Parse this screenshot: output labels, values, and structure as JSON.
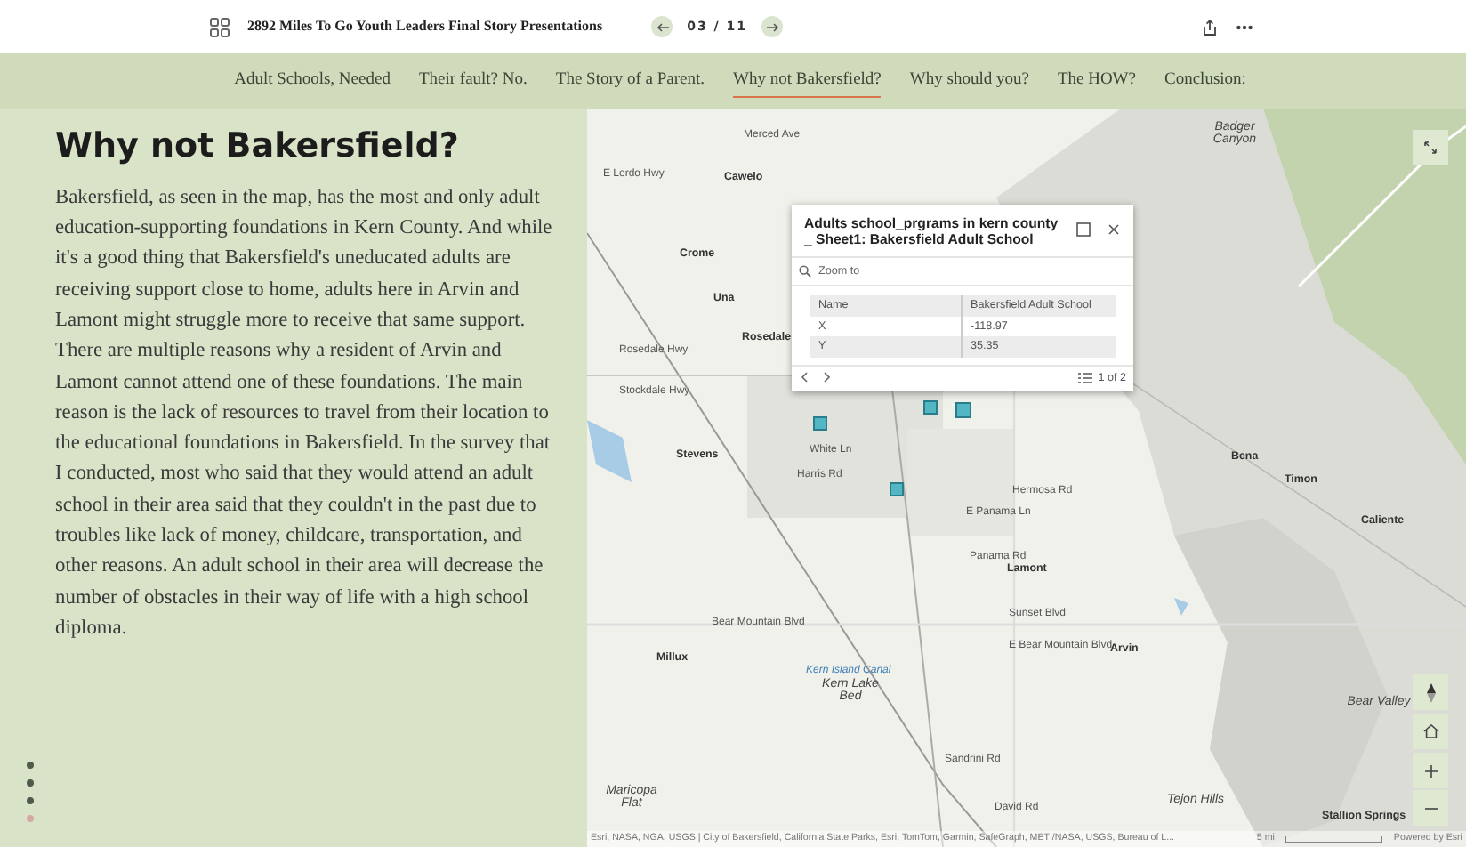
{
  "top_bar": {
    "title": "2892 Miles To Go Youth Leaders Final Story Presentations",
    "page_indicator": "03 / 11"
  },
  "nav": [
    {
      "label": "Adult Schools, Needed",
      "selected": false
    },
    {
      "label": "Their fault? No.",
      "selected": false
    },
    {
      "label": "The Story of a Parent.",
      "selected": false
    },
    {
      "label": "Why not Bakersfield?",
      "selected": true
    },
    {
      "label": "Why should you?",
      "selected": false
    },
    {
      "label": "The HOW?",
      "selected": false
    },
    {
      "label": "Conclusion:",
      "selected": false
    }
  ],
  "story": {
    "heading": "Why not Bakersfield?",
    "body": "Bakersfield, as seen in the map, has the most and only adult education-supporting foundations in Kern County. And while it's a good thing that Bakersfield's uneducated adults are receiving support close to home, adults here in Arvin and Lamont might struggle more to receive that same support. There are multiple reasons why a resident of Arvin and Lamont cannot attend one of these foundations. The main reason is the lack of resources to travel from their location to the educational foundations in Bakersfield. In the survey that I conducted, most who said that they would attend an adult school in their area said that they couldn't in the past due to troubles like lack of money, childcare, transportation, and other reasons. An adult school in their area will decrease the number of obstacles in their way of life with a high school diploma."
  },
  "slide_dots": [
    {
      "selected": false
    },
    {
      "selected": false
    },
    {
      "selected": false
    },
    {
      "selected": true
    }
  ],
  "map": {
    "labels": [
      {
        "text": "Merced Ave",
        "kind": "road"
      },
      {
        "text": "E Lerdo Hwy",
        "kind": "road"
      },
      {
        "text": "Cawelo",
        "kind": "place"
      },
      {
        "text": "Badger Canyon",
        "kind": "terrain"
      },
      {
        "text": "Crome",
        "kind": "place"
      },
      {
        "text": "Una",
        "kind": "place"
      },
      {
        "text": "Rosedale",
        "kind": "place"
      },
      {
        "text": "Rosedale Hwy",
        "kind": "road"
      },
      {
        "text": "Stockdale Hwy",
        "kind": "road"
      },
      {
        "text": "Stevens",
        "kind": "place"
      },
      {
        "text": "White Ln",
        "kind": "road"
      },
      {
        "text": "Harris Rd",
        "kind": "road"
      },
      {
        "text": "Hermosa Rd",
        "kind": "road"
      },
      {
        "text": "E Panama Ln",
        "kind": "road"
      },
      {
        "text": "Panama Rd",
        "kind": "road"
      },
      {
        "text": "Lamont",
        "kind": "place"
      },
      {
        "text": "Bena",
        "kind": "place"
      },
      {
        "text": "Timon",
        "kind": "place"
      },
      {
        "text": "Caliente",
        "kind": "place"
      },
      {
        "text": "Sunset Blvd",
        "kind": "road"
      },
      {
        "text": "Bear Mountain Blvd",
        "kind": "road"
      },
      {
        "text": "E Bear Mountain Blvd",
        "kind": "road"
      },
      {
        "text": "Arvin",
        "kind": "place"
      },
      {
        "text": "Millux",
        "kind": "place"
      },
      {
        "text": "Kern Island Canal",
        "kind": "water"
      },
      {
        "text": "Kern Lake Bed",
        "kind": "terrain"
      },
      {
        "text": "Bear Valley",
        "kind": "terrain"
      },
      {
        "text": "Sandrini Rd",
        "kind": "road"
      },
      {
        "text": "David Rd",
        "kind": "road"
      },
      {
        "text": "Maricopa Flat",
        "kind": "terrain"
      },
      {
        "text": "Tejon Hills",
        "kind": "terrain"
      },
      {
        "text": "Stallion Springs",
        "kind": "place"
      }
    ],
    "popup": {
      "title": "Adults school_prgrams in kern county _ Sheet1: Bakersfield Adult School",
      "zoom_to": "Zoom to",
      "fields": [
        {
          "name": "Name",
          "value": "Bakersfield Adult School"
        },
        {
          "name": "X",
          "value": "-118.97"
        },
        {
          "name": "Y",
          "value": "35.35"
        }
      ],
      "pager": "1 of 2"
    },
    "attribution": "Esri, NASA, NGA, USGS | City of Bakersfield, California State Parks, Esri, TomTom, Garmin, SafeGraph, METI/NASA, USGS, Bureau of L...",
    "scale": "5 mi",
    "powered_by": "Powered by Esri"
  }
}
